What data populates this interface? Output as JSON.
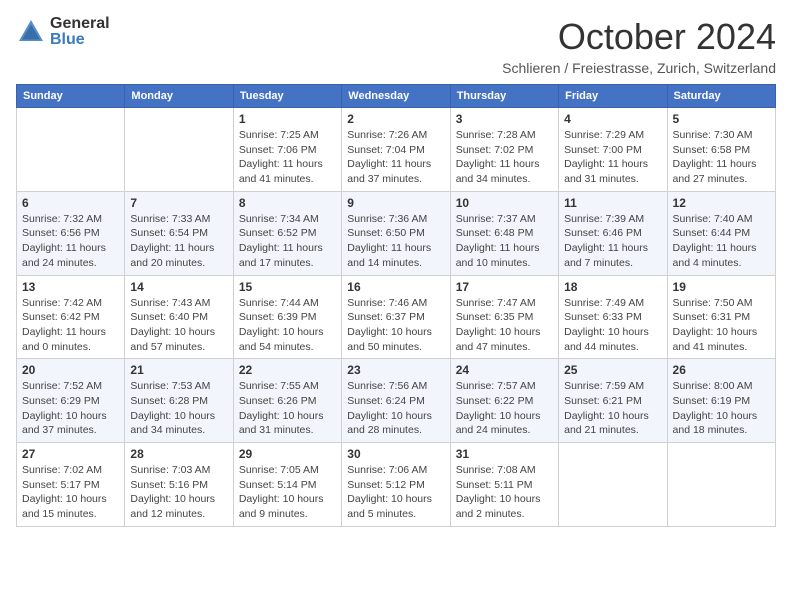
{
  "header": {
    "logo": {
      "text_general": "General",
      "text_blue": "Blue"
    },
    "title": "October 2024",
    "subtitle": "Schlieren / Freiestrasse, Zurich, Switzerland"
  },
  "calendar": {
    "days_of_week": [
      "Sunday",
      "Monday",
      "Tuesday",
      "Wednesday",
      "Thursday",
      "Friday",
      "Saturday"
    ],
    "weeks": [
      [
        {
          "day": "",
          "sunrise": "",
          "sunset": "",
          "daylight": ""
        },
        {
          "day": "",
          "sunrise": "",
          "sunset": "",
          "daylight": ""
        },
        {
          "day": "1",
          "sunrise": "Sunrise: 7:25 AM",
          "sunset": "Sunset: 7:06 PM",
          "daylight": "Daylight: 11 hours and 41 minutes."
        },
        {
          "day": "2",
          "sunrise": "Sunrise: 7:26 AM",
          "sunset": "Sunset: 7:04 PM",
          "daylight": "Daylight: 11 hours and 37 minutes."
        },
        {
          "day": "3",
          "sunrise": "Sunrise: 7:28 AM",
          "sunset": "Sunset: 7:02 PM",
          "daylight": "Daylight: 11 hours and 34 minutes."
        },
        {
          "day": "4",
          "sunrise": "Sunrise: 7:29 AM",
          "sunset": "Sunset: 7:00 PM",
          "daylight": "Daylight: 11 hours and 31 minutes."
        },
        {
          "day": "5",
          "sunrise": "Sunrise: 7:30 AM",
          "sunset": "Sunset: 6:58 PM",
          "daylight": "Daylight: 11 hours and 27 minutes."
        }
      ],
      [
        {
          "day": "6",
          "sunrise": "Sunrise: 7:32 AM",
          "sunset": "Sunset: 6:56 PM",
          "daylight": "Daylight: 11 hours and 24 minutes."
        },
        {
          "day": "7",
          "sunrise": "Sunrise: 7:33 AM",
          "sunset": "Sunset: 6:54 PM",
          "daylight": "Daylight: 11 hours and 20 minutes."
        },
        {
          "day": "8",
          "sunrise": "Sunrise: 7:34 AM",
          "sunset": "Sunset: 6:52 PM",
          "daylight": "Daylight: 11 hours and 17 minutes."
        },
        {
          "day": "9",
          "sunrise": "Sunrise: 7:36 AM",
          "sunset": "Sunset: 6:50 PM",
          "daylight": "Daylight: 11 hours and 14 minutes."
        },
        {
          "day": "10",
          "sunrise": "Sunrise: 7:37 AM",
          "sunset": "Sunset: 6:48 PM",
          "daylight": "Daylight: 11 hours and 10 minutes."
        },
        {
          "day": "11",
          "sunrise": "Sunrise: 7:39 AM",
          "sunset": "Sunset: 6:46 PM",
          "daylight": "Daylight: 11 hours and 7 minutes."
        },
        {
          "day": "12",
          "sunrise": "Sunrise: 7:40 AM",
          "sunset": "Sunset: 6:44 PM",
          "daylight": "Daylight: 11 hours and 4 minutes."
        }
      ],
      [
        {
          "day": "13",
          "sunrise": "Sunrise: 7:42 AM",
          "sunset": "Sunset: 6:42 PM",
          "daylight": "Daylight: 11 hours and 0 minutes."
        },
        {
          "day": "14",
          "sunrise": "Sunrise: 7:43 AM",
          "sunset": "Sunset: 6:40 PM",
          "daylight": "Daylight: 10 hours and 57 minutes."
        },
        {
          "day": "15",
          "sunrise": "Sunrise: 7:44 AM",
          "sunset": "Sunset: 6:39 PM",
          "daylight": "Daylight: 10 hours and 54 minutes."
        },
        {
          "day": "16",
          "sunrise": "Sunrise: 7:46 AM",
          "sunset": "Sunset: 6:37 PM",
          "daylight": "Daylight: 10 hours and 50 minutes."
        },
        {
          "day": "17",
          "sunrise": "Sunrise: 7:47 AM",
          "sunset": "Sunset: 6:35 PM",
          "daylight": "Daylight: 10 hours and 47 minutes."
        },
        {
          "day": "18",
          "sunrise": "Sunrise: 7:49 AM",
          "sunset": "Sunset: 6:33 PM",
          "daylight": "Daylight: 10 hours and 44 minutes."
        },
        {
          "day": "19",
          "sunrise": "Sunrise: 7:50 AM",
          "sunset": "Sunset: 6:31 PM",
          "daylight": "Daylight: 10 hours and 41 minutes."
        }
      ],
      [
        {
          "day": "20",
          "sunrise": "Sunrise: 7:52 AM",
          "sunset": "Sunset: 6:29 PM",
          "daylight": "Daylight: 10 hours and 37 minutes."
        },
        {
          "day": "21",
          "sunrise": "Sunrise: 7:53 AM",
          "sunset": "Sunset: 6:28 PM",
          "daylight": "Daylight: 10 hours and 34 minutes."
        },
        {
          "day": "22",
          "sunrise": "Sunrise: 7:55 AM",
          "sunset": "Sunset: 6:26 PM",
          "daylight": "Daylight: 10 hours and 31 minutes."
        },
        {
          "day": "23",
          "sunrise": "Sunrise: 7:56 AM",
          "sunset": "Sunset: 6:24 PM",
          "daylight": "Daylight: 10 hours and 28 minutes."
        },
        {
          "day": "24",
          "sunrise": "Sunrise: 7:57 AM",
          "sunset": "Sunset: 6:22 PM",
          "daylight": "Daylight: 10 hours and 24 minutes."
        },
        {
          "day": "25",
          "sunrise": "Sunrise: 7:59 AM",
          "sunset": "Sunset: 6:21 PM",
          "daylight": "Daylight: 10 hours and 21 minutes."
        },
        {
          "day": "26",
          "sunrise": "Sunrise: 8:00 AM",
          "sunset": "Sunset: 6:19 PM",
          "daylight": "Daylight: 10 hours and 18 minutes."
        }
      ],
      [
        {
          "day": "27",
          "sunrise": "Sunrise: 7:02 AM",
          "sunset": "Sunset: 5:17 PM",
          "daylight": "Daylight: 10 hours and 15 minutes."
        },
        {
          "day": "28",
          "sunrise": "Sunrise: 7:03 AM",
          "sunset": "Sunset: 5:16 PM",
          "daylight": "Daylight: 10 hours and 12 minutes."
        },
        {
          "day": "29",
          "sunrise": "Sunrise: 7:05 AM",
          "sunset": "Sunset: 5:14 PM",
          "daylight": "Daylight: 10 hours and 9 minutes."
        },
        {
          "day": "30",
          "sunrise": "Sunrise: 7:06 AM",
          "sunset": "Sunset: 5:12 PM",
          "daylight": "Daylight: 10 hours and 5 minutes."
        },
        {
          "day": "31",
          "sunrise": "Sunrise: 7:08 AM",
          "sunset": "Sunset: 5:11 PM",
          "daylight": "Daylight: 10 hours and 2 minutes."
        },
        {
          "day": "",
          "sunrise": "",
          "sunset": "",
          "daylight": ""
        },
        {
          "day": "",
          "sunrise": "",
          "sunset": "",
          "daylight": ""
        }
      ]
    ]
  }
}
